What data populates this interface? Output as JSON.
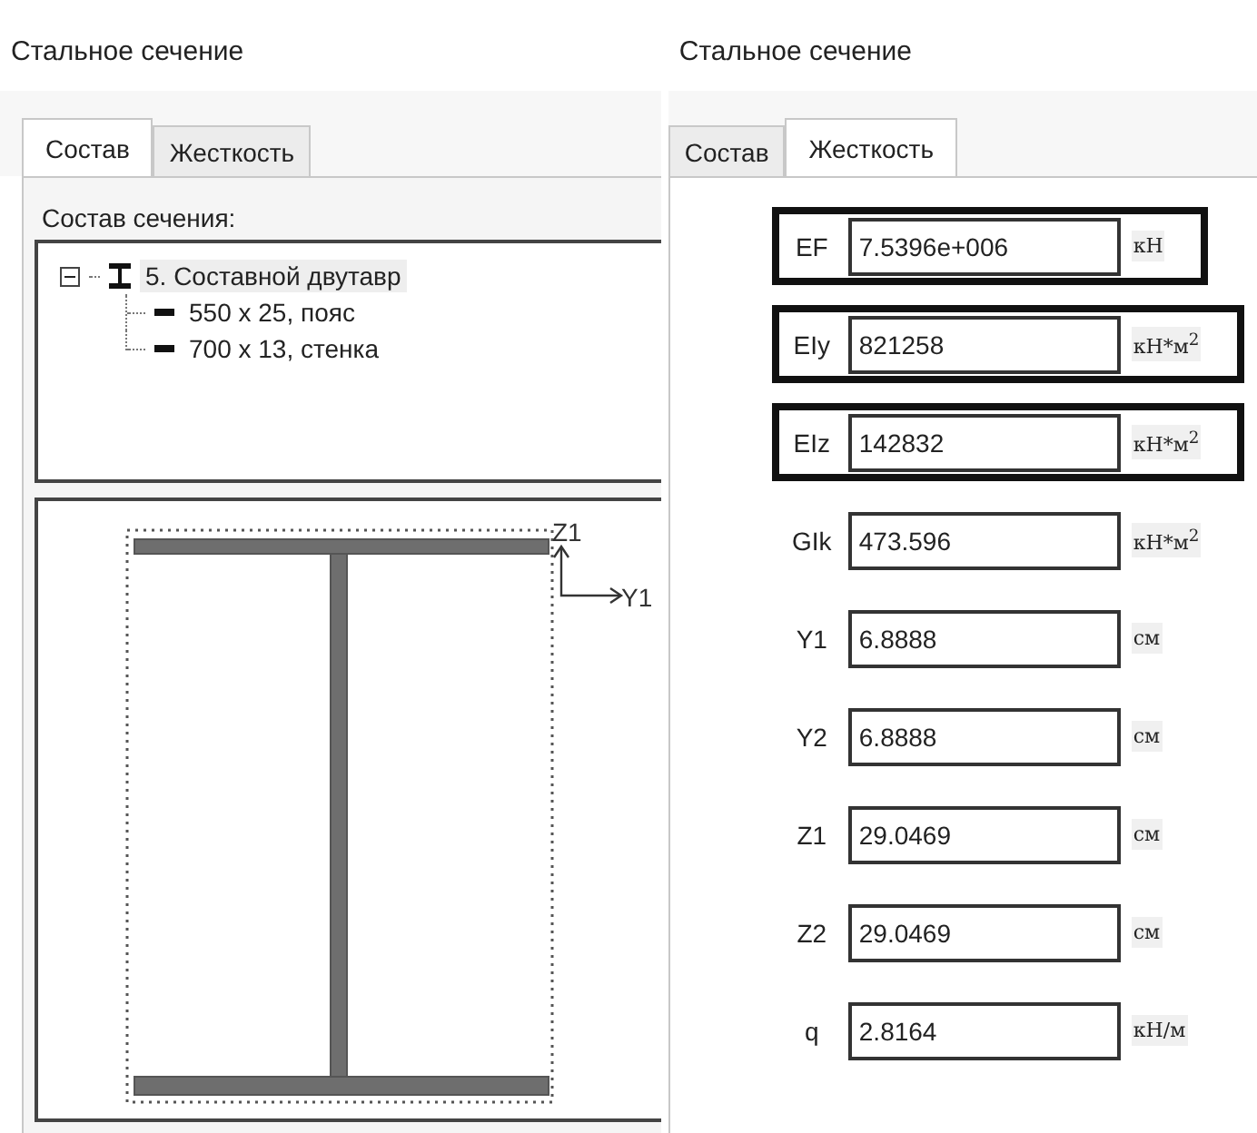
{
  "panels": [
    {
      "kind": "composition",
      "title": "Стальное сечение",
      "tabs": [
        {
          "label": "Состав",
          "selected": true
        },
        {
          "label": "Жесткость",
          "selected": false
        }
      ],
      "section_label": "Состав сечения:",
      "tree": [
        {
          "label": "5. Составной двутавр",
          "kind": "ibeam",
          "expanded": true,
          "selected": true,
          "children": [
            {
              "label": "550 x 25, пояс",
              "kind": "plate",
              "selected": false
            },
            {
              "label": "700 x 13, стенка",
              "kind": "plate",
              "selected": false
            }
          ]
        }
      ],
      "axis_labels": {
        "vertical": "Z1",
        "horizontal": "Y1"
      }
    },
    {
      "kind": "stiffness",
      "title": "Стальное сечение",
      "tabs": [
        {
          "label": "Состав",
          "selected": false
        },
        {
          "label": "Жесткость",
          "selected": true
        }
      ],
      "rows": [
        {
          "label": "EF",
          "value": "7.5396e+006",
          "unit": "кН",
          "highlighted": true
        },
        {
          "label": "EIy",
          "value": "821258",
          "unit": "кН*м$^{2}$",
          "highlighted": true
        },
        {
          "label": "EIz",
          "value": "142832",
          "unit": "кН*м$^{2}$",
          "highlighted": true
        },
        {
          "label": "GIk",
          "value": "473.596",
          "unit": "кН*м$^{2}$",
          "highlighted": false
        },
        {
          "label": "Y1",
          "value": "6.8888",
          "unit": "см",
          "highlighted": false
        },
        {
          "label": "Y2",
          "value": "6.8888",
          "unit": "см",
          "highlighted": false
        },
        {
          "label": "Z1",
          "value": "29.0469",
          "unit": "см",
          "highlighted": false
        },
        {
          "label": "Z2",
          "value": "29.0469",
          "unit": "см",
          "highlighted": false
        },
        {
          "label": "q",
          "value": "2.8164",
          "unit": "кН/м",
          "highlighted": false
        }
      ]
    }
  ]
}
